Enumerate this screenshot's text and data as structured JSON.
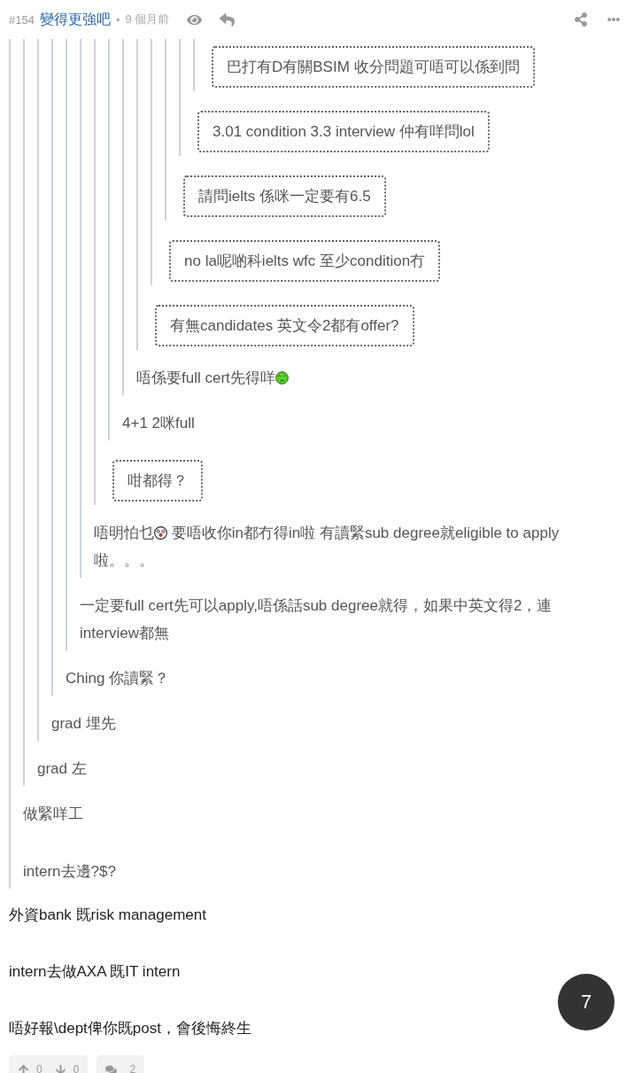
{
  "header": {
    "floor": "#154",
    "author": "變得更強吧",
    "separator": "•",
    "time": "9 個月前"
  },
  "quote": {
    "kind": "plain",
    "paragraphs": [
      [
        {
          "kind": "text",
          "text": "做緊咩工"
        }
      ],
      [
        {
          "kind": "text",
          "text": "intern去邊?$?"
        }
      ]
    ],
    "quote": {
      "kind": "plain",
      "paragraphs": [
        [
          {
            "kind": "text",
            "text": "grad 左"
          }
        ]
      ],
      "quote": {
        "kind": "plain",
        "paragraphs": [
          [
            {
              "kind": "text",
              "text": "grad 埋先"
            }
          ]
        ],
        "quote": {
          "kind": "plain",
          "paragraphs": [
            [
              {
                "kind": "text",
                "text": "Ching 你讀緊？"
              }
            ]
          ],
          "quote": {
            "kind": "plain",
            "paragraphs": [
              [
                {
                  "kind": "text",
                  "text": "一定要full cert先可以apply,唔係話sub degree就得，如果中英文得2，連interview都無"
                }
              ]
            ],
            "quote": {
              "kind": "plain",
              "paragraphs": [
                [
                  {
                    "kind": "text",
                    "text": "唔明怕乜"
                  },
                  {
                    "kind": "dizzy-emoji"
                  },
                  {
                    "kind": "text",
                    "text": " 要唔收你in都冇得in啦 有讀緊sub degree就eligible to apply"
                  },
                  {
                    "kind": "text-line",
                    "text": "啦。。。"
                  }
                ]
              ],
              "quote": {
                "kind": "boxed",
                "paragraphs": [
                  [
                    {
                      "kind": "text",
                      "text": "咁都得？"
                    }
                  ]
                ],
                "quote": {
                  "kind": "plain",
                  "paragraphs": [
                    [
                      {
                        "kind": "text",
                        "text": "4+1 2咪full"
                      }
                    ]
                  ],
                  "quote": {
                    "kind": "plain",
                    "paragraphs": [
                      [
                        {
                          "kind": "text",
                          "text": "唔係要full cert先得咩"
                        },
                        {
                          "kind": "confused-emoji"
                        }
                      ]
                    ],
                    "quote": {
                      "kind": "boxed",
                      "paragraphs": [
                        [
                          {
                            "kind": "text",
                            "text": "有無candidates 英文令2都有offer?"
                          }
                        ]
                      ],
                      "quote": {
                        "kind": "boxed",
                        "paragraphs": [
                          [
                            {
                              "kind": "text",
                              "text": "no la呢啲科ielts wfc 至少condition冇"
                            }
                          ]
                        ],
                        "quote": {
                          "kind": "boxed",
                          "paragraphs": [
                            [
                              {
                                "kind": "text",
                                "text": "請問ielts 係咪一定要有6.5"
                              }
                            ]
                          ],
                          "quote": {
                            "kind": "boxed",
                            "paragraphs": [
                              [
                                {
                                  "kind": "text",
                                  "text": "3.01 condition 3.3 interview 仲有咩問lol"
                                }
                              ]
                            ],
                            "quote": {
                              "kind": "boxed",
                              "paragraphs": [
                                [
                                  {
                                    "kind": "text",
                                    "text": "巴打有D有關BSIM 收分問題可唔可以係到問"
                                  }
                                ]
                              ]
                            }
                          }
                        }
                      }
                    }
                  }
                }
              }
            }
          }
        }
      }
    }
  },
  "body": [
    "外資bank 既risk management",
    "intern去做AXA 既IT intern",
    "唔好報\\dept俾你既post，會後悔終生"
  ],
  "footer": {
    "upvotes": "0",
    "downvotes": "0",
    "comments": "2"
  },
  "page_badge": "7"
}
